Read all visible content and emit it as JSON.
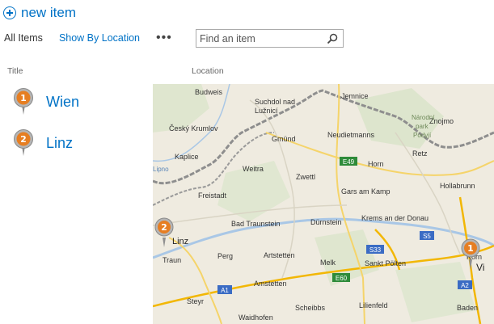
{
  "toolbar": {
    "new_item_label": "new item"
  },
  "views": {
    "all_items": "All Items",
    "show_by_location": "Show By Location",
    "more": "•••"
  },
  "search": {
    "placeholder": "Find an item",
    "value": ""
  },
  "columns": {
    "title": "Title",
    "location": "Location"
  },
  "items": [
    {
      "pin": "1",
      "title": "Wien"
    },
    {
      "pin": "2",
      "title": "Linz"
    }
  ],
  "map": {
    "pins": [
      "2",
      "1"
    ],
    "places": {
      "budweis": "Budweis",
      "suchdol": "Suchdol nad",
      "luznici": "Lužnicí",
      "jemnice": "Jemnice",
      "cesky": "Český Krumlov",
      "gmund": "Gmünd",
      "neudiet": "Neudietmanns",
      "znojmo": "Znojmo",
      "narodni1": "Národní",
      "narodni2": "park",
      "narodni3": "Podyjí",
      "retz": "Retz",
      "kaplice": "Kaplice",
      "weitra": "Weitra",
      "zwettl": "Zwettl",
      "horn": "Horn",
      "hollabrunn": "Hollabrunn",
      "freistadt": "Freistadt",
      "gars": "Gars am Kamp",
      "lipno": "Lipno",
      "badtraun": "Bad Traunstein",
      "durnstein": "Dürnstein",
      "krems": "Krems an der Donau",
      "linz": "Linz",
      "traun": "Traun",
      "perg": "Perg",
      "artstetten": "Artstetten",
      "melk": "Melk",
      "stpolten": "Sankt Pölten",
      "korn": "Korn",
      "vi": "Vi",
      "amstetten": "Amstetten",
      "steyr": "Steyr",
      "scheibbs": "Scheibbs",
      "lilienfeld": "Lilienfeld",
      "baden": "Baden",
      "waidhofen": "Waidhofen"
    },
    "roads": {
      "e49": "E49",
      "s33": "S33",
      "s5": "S5",
      "e60": "E60",
      "a1": "A1",
      "a2": "A2"
    }
  }
}
